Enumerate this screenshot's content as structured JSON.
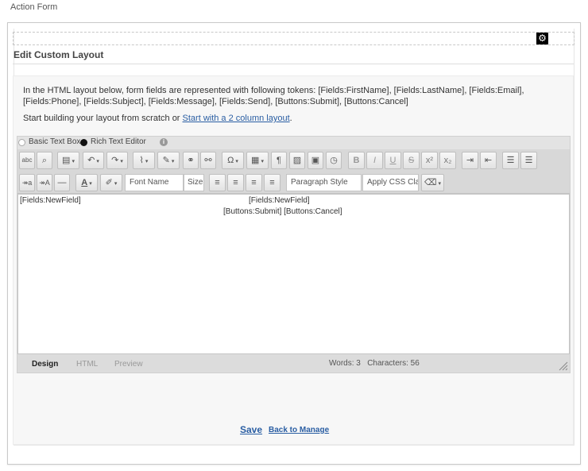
{
  "page": {
    "title": "Action Form"
  },
  "section": {
    "title": "Edit Custom Layout"
  },
  "intro": {
    "line1": "In the HTML layout below, form fields are represented with following tokens: [Fields:FirstName], [Fields:LastName], [Fields:Email], [Fields:Phone], [Fields:Subject], [Fields:Message], [Fields:Send], [Buttons:Submit], [Buttons:Cancel]",
    "line2_prefix": "Start building your layout from scratch or ",
    "line2_link": "Start with a 2 column layout",
    "line2_suffix": "."
  },
  "editor_mode": {
    "options": [
      "Basic Text Box",
      "Rich Text Editor"
    ],
    "selected": "Rich Text Editor",
    "info_icon": "info-icon"
  },
  "toolbar": {
    "font_name": "Font Name",
    "size": "Size",
    "paragraph_style": "Paragraph Style",
    "apply_css": "Apply CSS Class",
    "icons": {
      "spellcheck": "abc",
      "find": "⌕",
      "paste": "▤",
      "undo": "↶",
      "redo": "↷",
      "attach": "⌇",
      "edit": "✎",
      "link": "⚭",
      "unlink": "⚯",
      "symbol": "Ω",
      "table": "▦",
      "paragraph": "¶",
      "image": "▨",
      "date": "▣",
      "time": "◷",
      "bold": "B",
      "italic": "I",
      "underline": "U",
      "strike": "S",
      "superscript": "x²",
      "subscript": "x₂",
      "indent": "⇥",
      "outdent": "⇤",
      "ordered_list": "☰",
      "unordered_list": "☰",
      "convert_lower": "↠a",
      "convert_upper": "↠A",
      "hr": "—",
      "font_color": "A",
      "highlight": "✐",
      "align_left": "≡",
      "align_center": "≡",
      "align_right": "≡",
      "justify": "≡",
      "eraser": "⌫",
      "dropdown": "▾"
    }
  },
  "design": {
    "field_left": "[Fields:NewField]",
    "field_mid": "[Fields:NewField]",
    "buttons": "[Buttons:Submit] [Buttons:Cancel]"
  },
  "status": {
    "tabs": [
      "Design",
      "HTML",
      "Preview"
    ],
    "active_tab": "Design",
    "words": "Words: 3",
    "characters": "Characters: 56"
  },
  "actions": {
    "save": "Save",
    "back": "Back to Manage"
  },
  "colors": {
    "link": "#2a5ea3",
    "toolbar": "#d8d8d8",
    "panel": "#f7f7f7"
  }
}
